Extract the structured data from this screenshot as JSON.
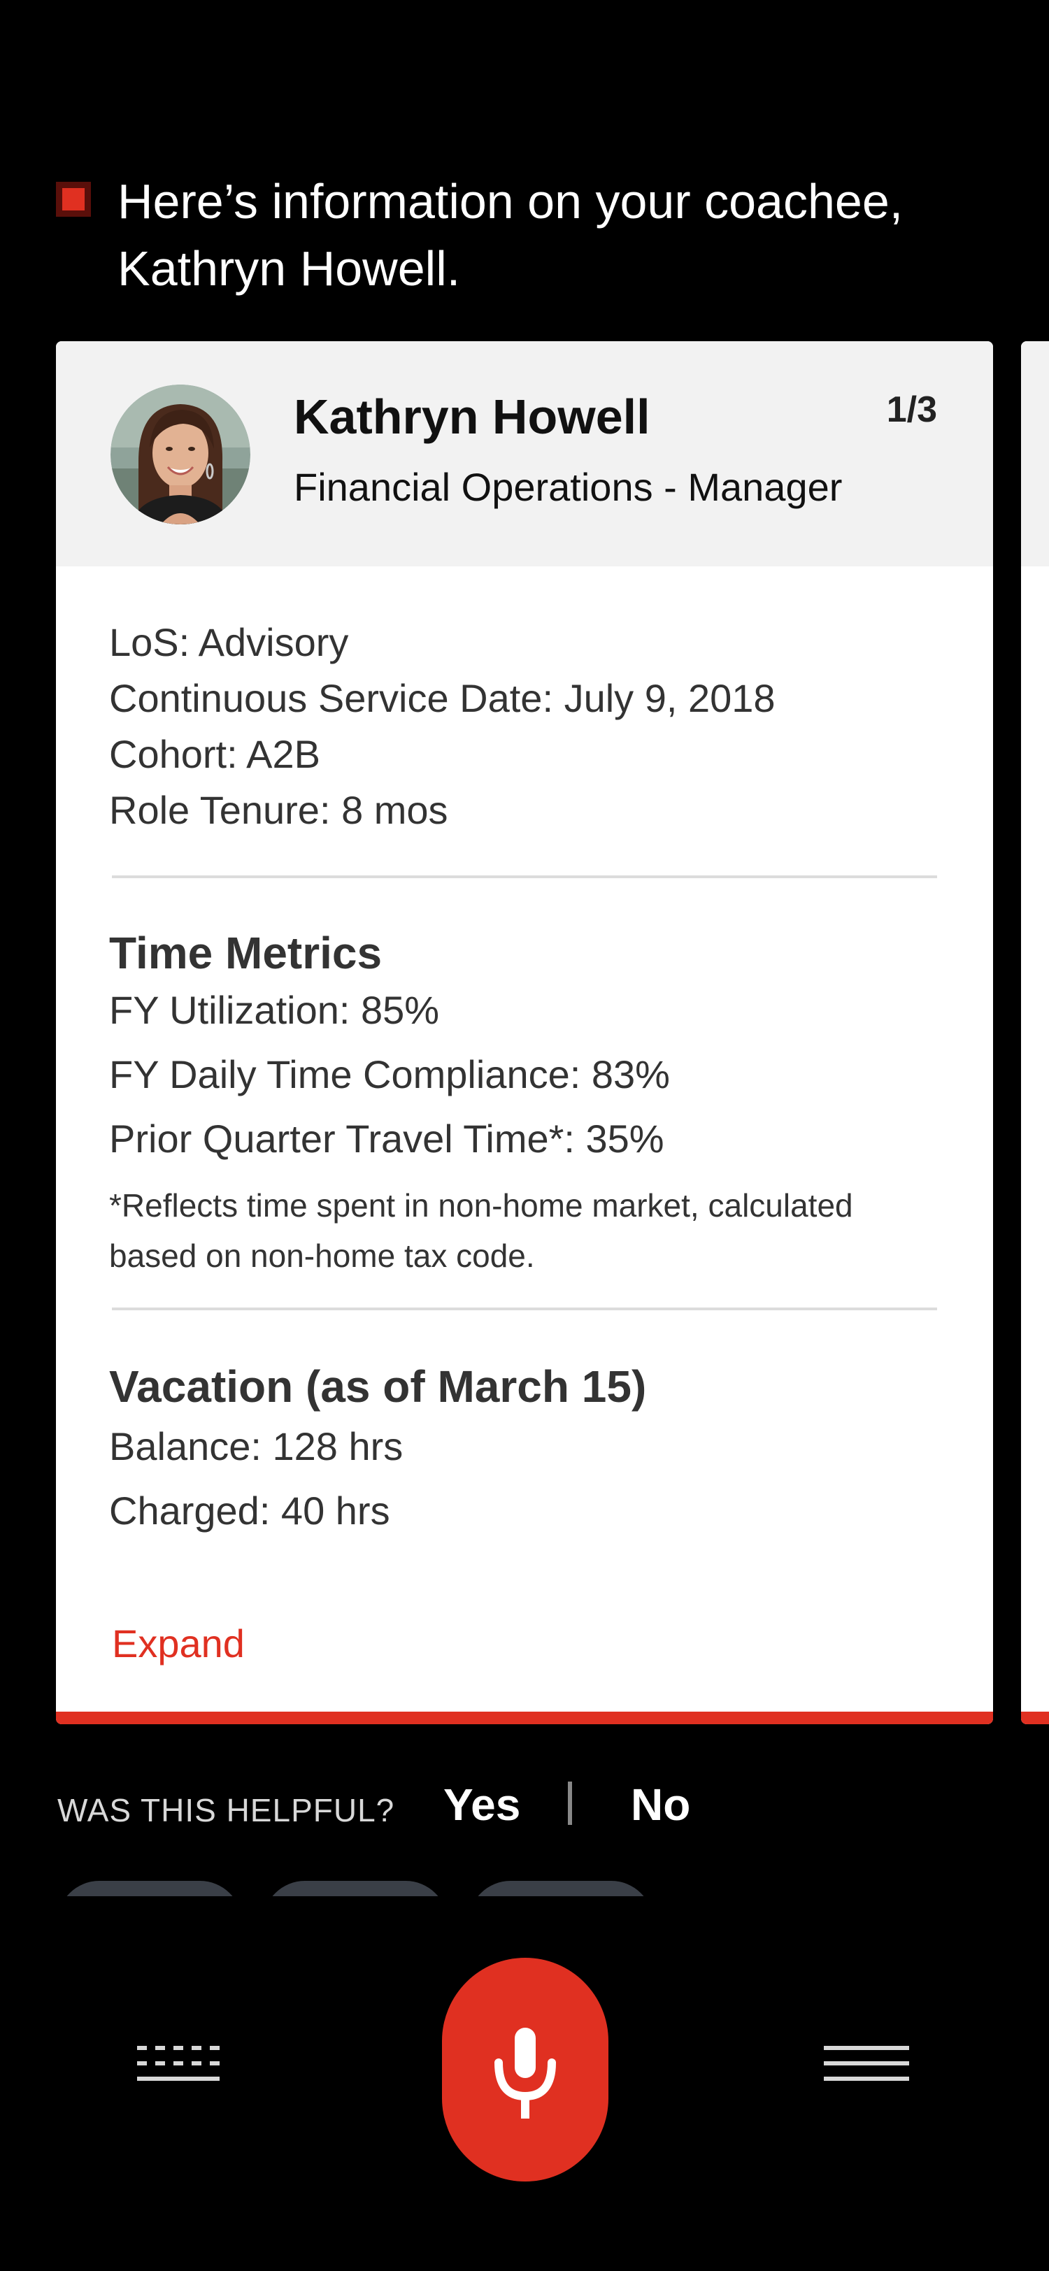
{
  "assistant": {
    "message": "Here’s information on your coachee, Kathryn Howell."
  },
  "card": {
    "counter": "1/3",
    "name": "Kathryn Howell",
    "role": "Financial Operations - Manager",
    "details": [
      "LoS: Advisory",
      "Continuous Service Date: July 9, 2018",
      "Cohort: A2B",
      "Role Tenure: 8 mos"
    ],
    "time_metrics": {
      "title": "Time Metrics",
      "items": [
        "FY Utilization: 85%",
        "FY Daily Time Compliance: 83%",
        "Prior Quarter Travel Time*: 35%"
      ],
      "footnote": "*Reflects time spent in non-home market, calculated based on non-home tax code."
    },
    "vacation": {
      "title": "Vacation (as of March 15)",
      "items": [
        "Balance: 128 hrs",
        "Charged: 40 hrs"
      ]
    },
    "expand_label": "Expand"
  },
  "feedback": {
    "question": "WAS THIS HELPFUL?",
    "yes_label": "Yes",
    "no_label": "No"
  },
  "icons": {
    "mic": "microphone-icon",
    "keyboard": "keyboard-icon",
    "menu": "menu-icon"
  },
  "colors": {
    "background": "#000000",
    "accent": "#e03021",
    "card_header": "#f2f2f2",
    "card_body": "#ffffff",
    "chip": "#3a3f47"
  }
}
